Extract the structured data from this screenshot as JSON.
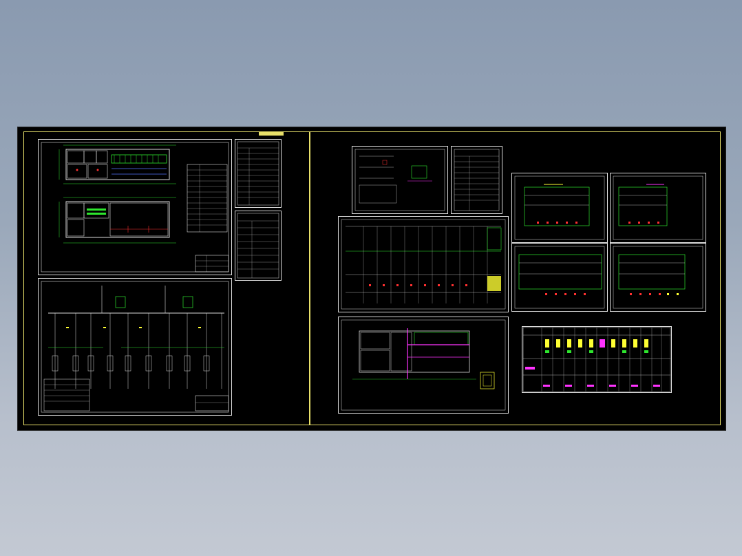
{
  "colors": {
    "background_top": "#8a9ab0",
    "background_bottom": "#c3c9d3",
    "canvas": "#000000",
    "sheet_border": "#e8e06a",
    "line_white": "#dddddd",
    "accent_green": "#2ee62e",
    "accent_magenta": "#ff33ff",
    "accent_red": "#ff3030",
    "accent_yellow": "#ffff33",
    "accent_cyan": "#33ffff",
    "accent_blue": "#5577ff"
  },
  "sheets": [
    {
      "name": "left-sheet"
    },
    {
      "name": "right-sheet"
    }
  ]
}
